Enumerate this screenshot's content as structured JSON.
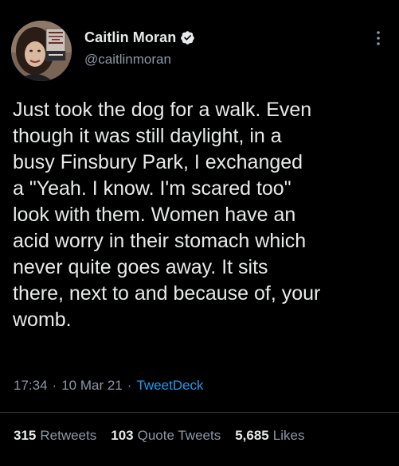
{
  "author": {
    "display_name": "Caitlin Moran",
    "handle": "@caitlinmoran",
    "avatar_icon": "avatar-photo",
    "avatar_book_text": "MORE THAN A WOMAN",
    "verified_icon": "verified-badge-icon"
  },
  "tweet": {
    "text": "Just took the dog for a walk. Even\nthough it was still daylight, in a\nbusy Finsbury Park, I exchanged\na \"Yeah. I know. I'm scared too\"\nlook with them. Women have an\nacid worry in their stomach which\nnever quite goes away. It sits\nthere, next to and because of, your\nwomb.",
    "time": "17:34",
    "date": "10 Mar 21",
    "separator": "·",
    "source": "TweetDeck"
  },
  "stats": {
    "retweets_count": "315",
    "retweets_label": "Retweets",
    "quotes_count": "103",
    "quotes_label": "Quote Tweets",
    "likes_count": "5,685",
    "likes_label": "Likes"
  },
  "colors": {
    "background": "#000000",
    "text_primary": "#e7e9ea",
    "text_secondary": "#8b98a5",
    "link": "#1d9bf0",
    "divider": "#2f3336"
  }
}
